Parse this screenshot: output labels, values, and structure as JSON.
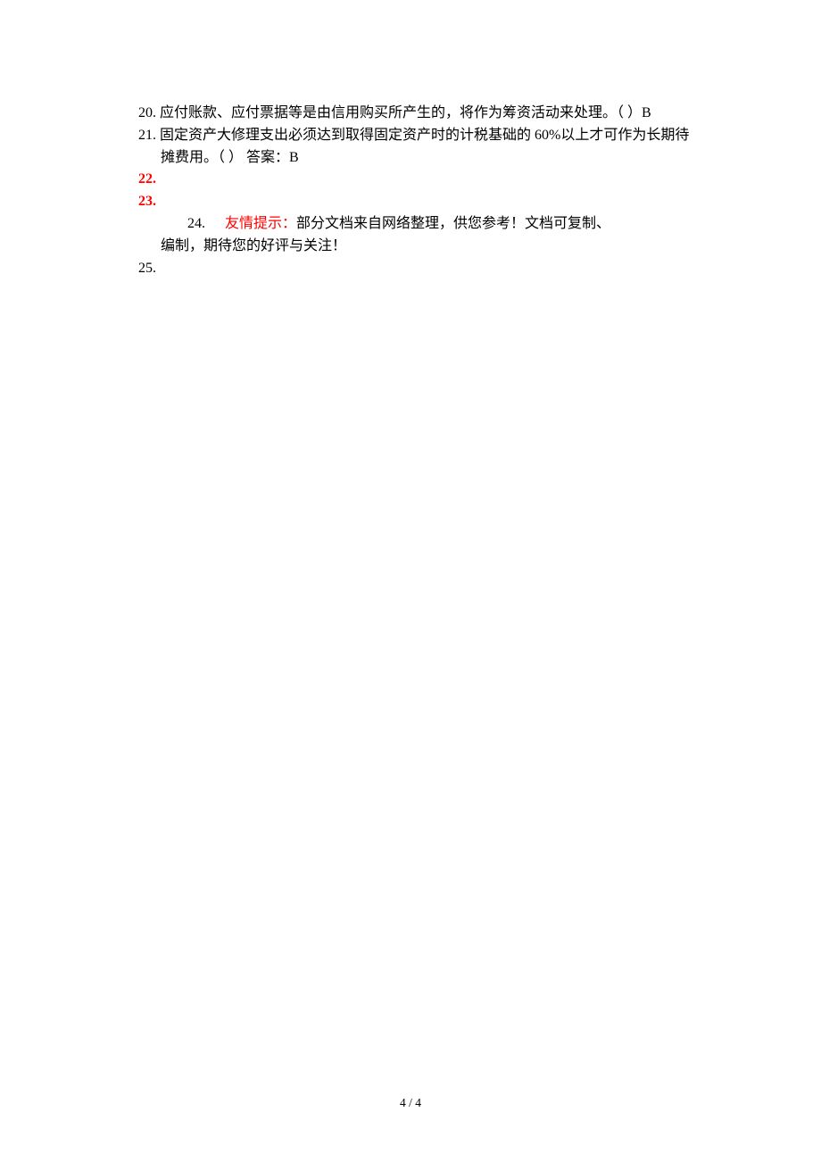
{
  "items": {
    "q20": {
      "num": "20.",
      "text": "应付账款、应付票据等是由信用购买所产生的，将作为筹资活动来处理。（  ）B"
    },
    "q21": {
      "num": "21.",
      "line1": "固定资产大修理支出必须达到取得固定资产时的计税基础的 60%以上才可作为长期待",
      "line2": "摊费用。（  ）  答案：B"
    },
    "q22": "22.",
    "q23": "23.",
    "q24": {
      "num": "24.",
      "tipLabel": "友情提示：",
      "tipText": "部分文档来自网络整理，供您参考！文档可复制、",
      "line2": "编制，期待您的好评与关注！"
    },
    "q25": "25."
  },
  "footer": "4  /  4"
}
